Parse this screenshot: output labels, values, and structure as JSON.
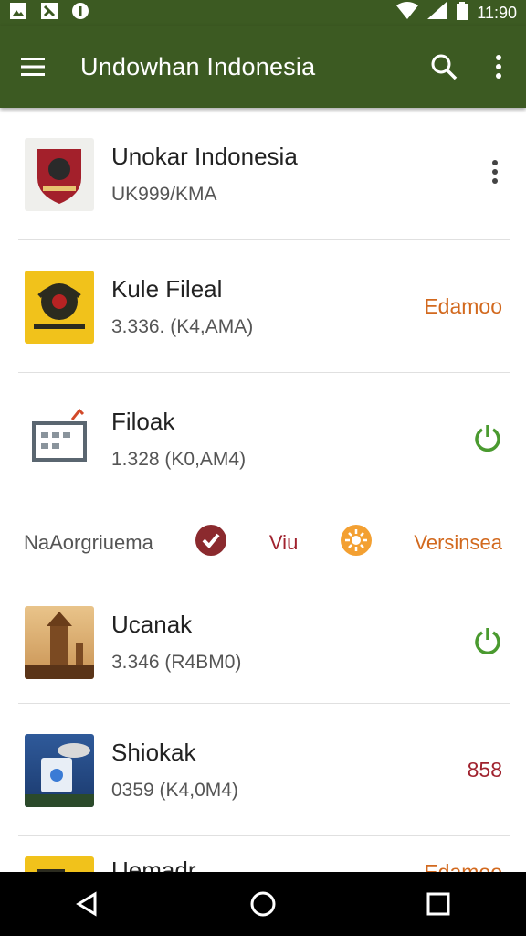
{
  "status": {
    "time": "11:90"
  },
  "appbar": {
    "title": "Undowhan Indonesia"
  },
  "items": [
    {
      "title": "Unokar Indonesia",
      "subtitle": "UK999/KMA",
      "trailing": ""
    },
    {
      "title": "Kule Fileal",
      "subtitle": "3.336. (K4,AMA)",
      "trailing": "Edamoo"
    },
    {
      "title": "Filoak",
      "subtitle": "1.328 (K0,AM4)",
      "trailing": ""
    }
  ],
  "chips": {
    "label1": "NaAorgriuema",
    "label2": "Viu",
    "label3": "Versinsea"
  },
  "items2": [
    {
      "title": "Ucanak",
      "subtitle": "3.346 (R4BM0)",
      "trailing": ""
    },
    {
      "title": "Shiokak",
      "subtitle": "0359 (K4,0M4)",
      "trailing": "858"
    },
    {
      "title": "Uemadr",
      "subtitle": "",
      "trailing": "Edamoo"
    }
  ],
  "colors": {
    "appbar": "#3c5a22",
    "accent_orange": "#d2691e",
    "accent_green": "#4a9a2f",
    "accent_red": "#a0222e"
  }
}
